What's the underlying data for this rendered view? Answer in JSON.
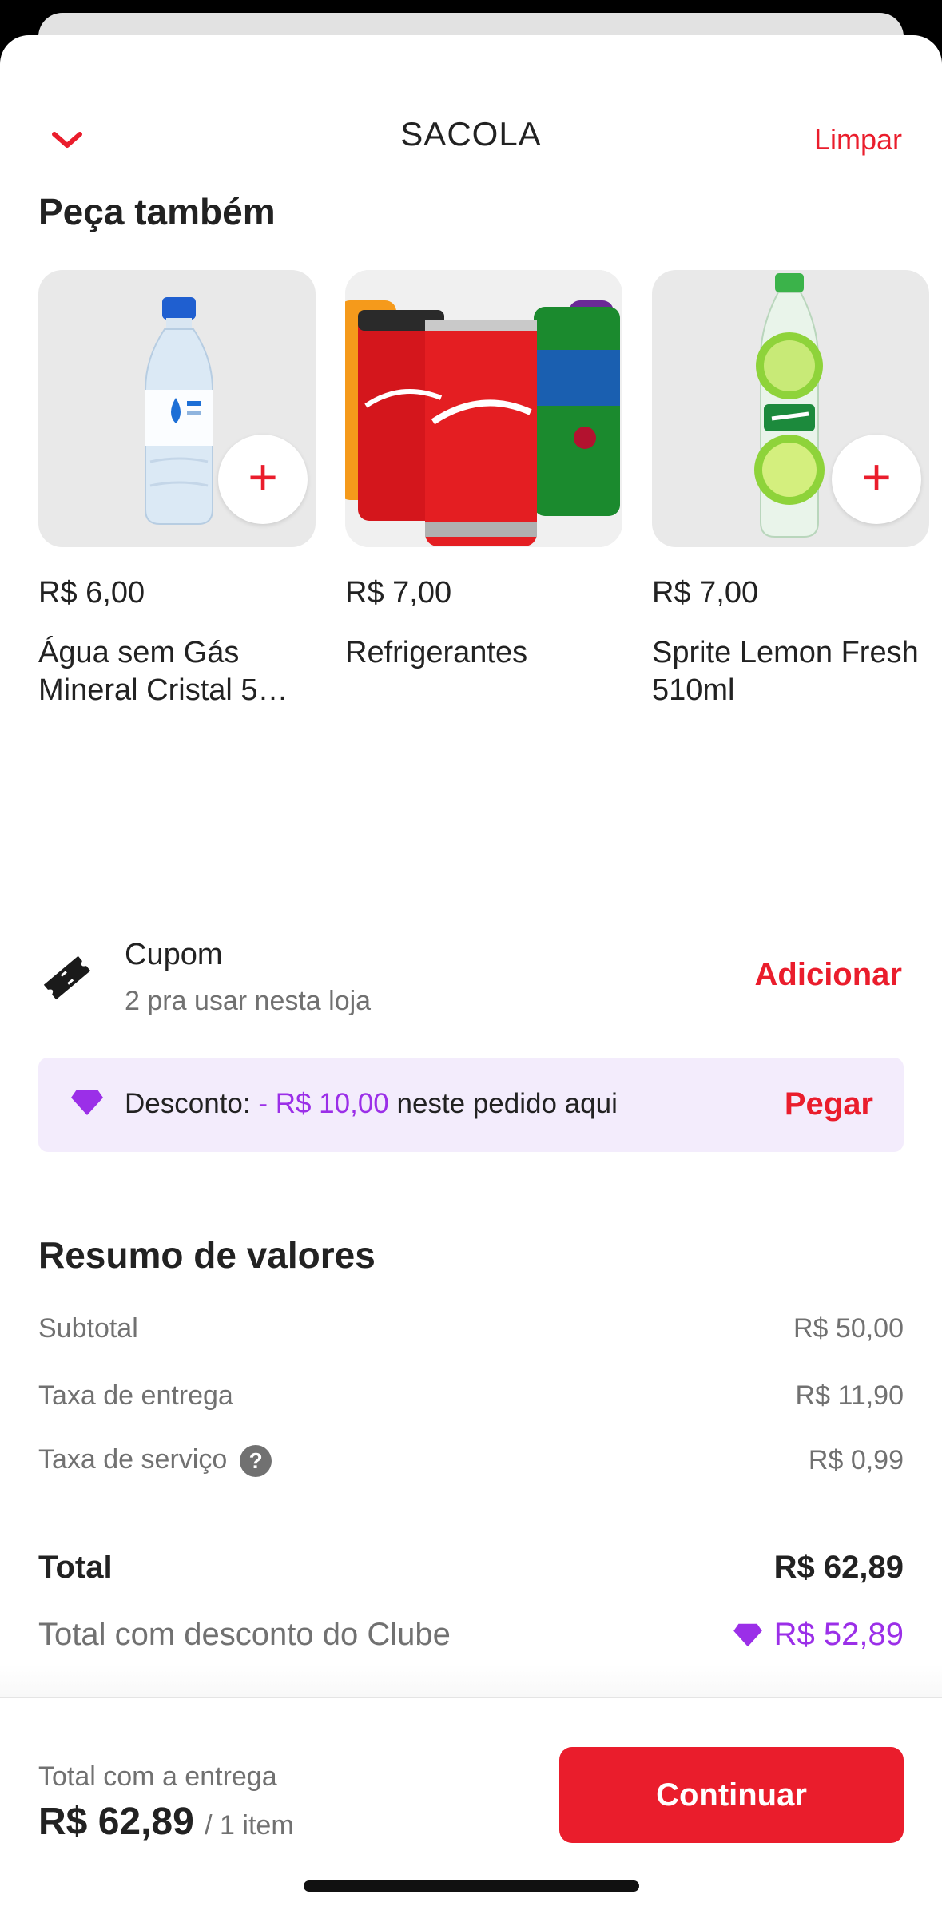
{
  "header": {
    "title": "SACOLA",
    "clear_label": "Limpar"
  },
  "suggestions": {
    "title": "Peça também",
    "items": [
      {
        "price": "R$ 6,00",
        "name": "Água sem Gás Mineral Cristal 5…",
        "image": "water-bottle-image"
      },
      {
        "price": "R$ 7,00",
        "name": "Refrigerantes",
        "image": "soda-cans-image"
      },
      {
        "price": "R$ 7,00",
        "name": "Sprite Lemon Fresh 510ml",
        "image": "sprite-bottle-image"
      }
    ],
    "add_icon": "+"
  },
  "coupon": {
    "title": "Cupom",
    "subtitle": "2 pra usar nesta loja",
    "action": "Adicionar"
  },
  "discount": {
    "label": "Desconto:",
    "value": "- R$ 10,00",
    "suffix": "neste pedido aqui",
    "action": "Pegar"
  },
  "summary": {
    "title": "Resumo de valores",
    "subtotal_label": "Subtotal",
    "subtotal_value": "R$ 50,00",
    "delivery_label": "Taxa de entrega",
    "delivery_value": "R$ 11,90",
    "service_label": "Taxa de serviço",
    "service_value": "R$ 0,99",
    "total_label": "Total",
    "total_value": "R$ 62,89",
    "club_label": "Total com desconto do Clube",
    "club_value": "R$ 52,89"
  },
  "footer": {
    "label": "Total com a entrega",
    "amount": "R$ 62,89",
    "items": "/ 1 item",
    "continue_label": "Continuar"
  },
  "colors": {
    "brand": "#ea1d2c",
    "club": "#9b2fe8",
    "club_bg": "#f3ecfc"
  }
}
